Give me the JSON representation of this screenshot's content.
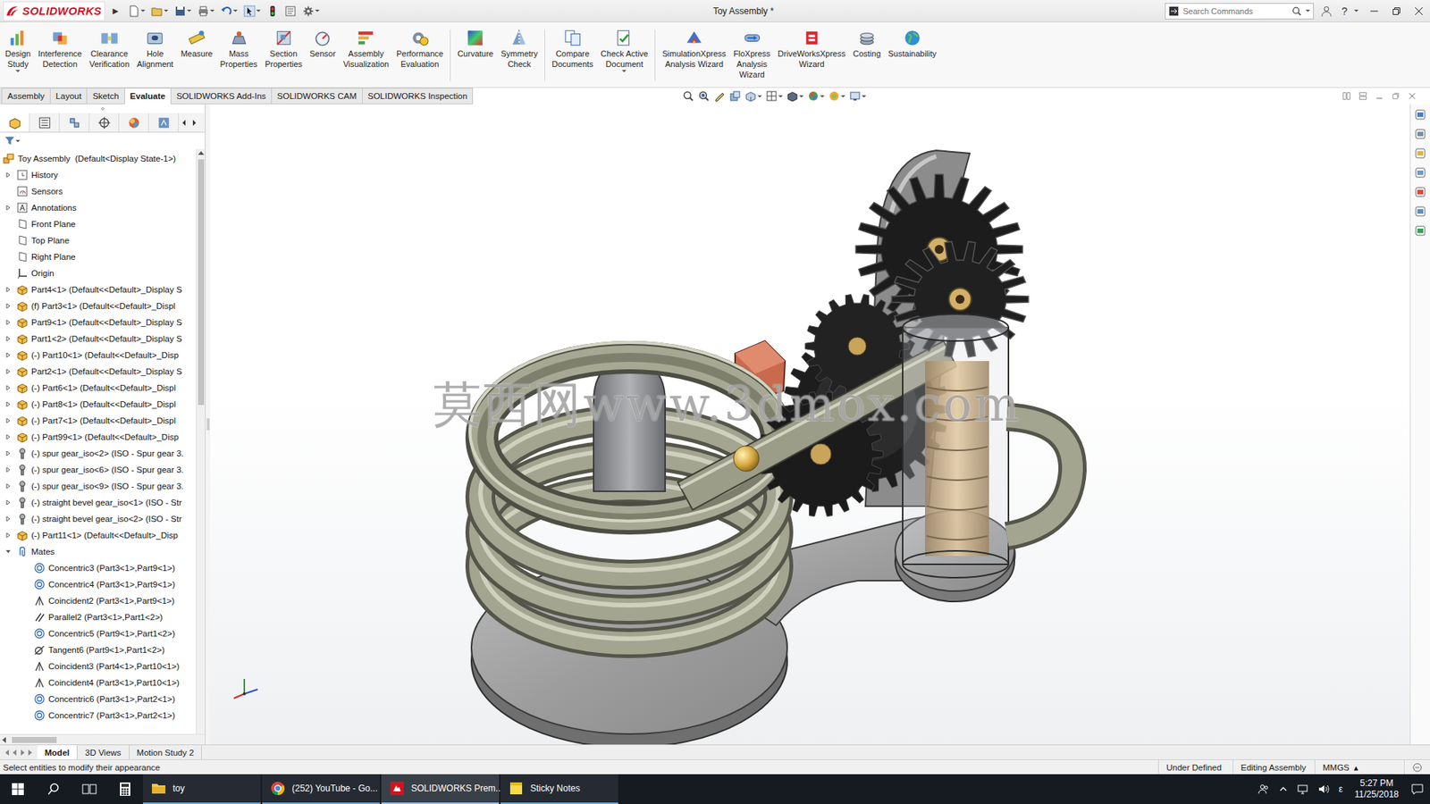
{
  "window": {
    "app_name": "SOLIDWORKS",
    "menu_arrow": "▶",
    "title": "Toy Assembly *",
    "search_placeholder": "Search Commands",
    "help": "?"
  },
  "ribbon": [
    {
      "lines": [
        "Design",
        "Study"
      ],
      "dropdown": true
    },
    {
      "lines": [
        "Interference",
        "Detection"
      ],
      "dropdown": false
    },
    {
      "lines": [
        "Clearance",
        "Verification"
      ],
      "dropdown": false
    },
    {
      "lines": [
        "Hole",
        "Alignment"
      ],
      "dropdown": false
    },
    {
      "lines": [
        "Measure"
      ],
      "dropdown": false
    },
    {
      "lines": [
        "Mass",
        "Properties"
      ],
      "dropdown": false
    },
    {
      "lines": [
        "Section",
        "Properties"
      ],
      "dropdown": false
    },
    {
      "lines": [
        "Sensor"
      ],
      "dropdown": false
    },
    {
      "lines": [
        "Assembly",
        "Visualization"
      ],
      "dropdown": false
    },
    {
      "lines": [
        "Performance",
        "Evaluation"
      ],
      "dropdown": false
    },
    {
      "lines": [
        "Curvature"
      ],
      "dropdown": false
    },
    {
      "lines": [
        "Symmetry",
        "Check"
      ],
      "dropdown": false
    },
    {
      "lines": [
        "Compare",
        "Documents"
      ],
      "dropdown": false
    },
    {
      "lines": [
        "Check Active",
        "Document"
      ],
      "dropdown": true
    },
    {
      "lines": [
        "SimulationXpress",
        "Analysis Wizard"
      ],
      "dropdown": false
    },
    {
      "lines": [
        "FloXpress",
        "Analysis",
        "Wizard"
      ],
      "dropdown": false
    },
    {
      "lines": [
        "DriveWorksXpress",
        "Wizard"
      ],
      "dropdown": false
    },
    {
      "lines": [
        "Costing"
      ],
      "dropdown": false
    },
    {
      "lines": [
        "Sustainability"
      ],
      "dropdown": false
    }
  ],
  "tabs": [
    {
      "label": "Assembly",
      "selected": false
    },
    {
      "label": "Layout",
      "selected": false
    },
    {
      "label": "Sketch",
      "selected": false
    },
    {
      "label": "Evaluate",
      "selected": true
    },
    {
      "label": "SOLIDWORKS Add-Ins",
      "selected": false
    },
    {
      "label": "SOLIDWORKS CAM",
      "selected": false
    },
    {
      "label": "SOLIDWORKS Inspection",
      "selected": false
    }
  ],
  "tree": [
    {
      "label": "Toy Assembly  (Default<Display State-1>)",
      "kind": "assembly",
      "expandable": false,
      "expanded": false,
      "indent": 0
    },
    {
      "label": "History",
      "kind": "history",
      "expandable": true,
      "expanded": false,
      "indent": 0
    },
    {
      "label": "Sensors",
      "kind": "sensor",
      "expandable": false,
      "expanded": false,
      "indent": 0
    },
    {
      "label": "Annotations",
      "kind": "annotation",
      "expandable": true,
      "expanded": false,
      "indent": 0
    },
    {
      "label": "Front Plane",
      "kind": "plane",
      "expandable": false,
      "expanded": false,
      "indent": 0
    },
    {
      "label": "Top Plane",
      "kind": "plane",
      "expandable": false,
      "expanded": false,
      "indent": 0
    },
    {
      "label": "Right Plane",
      "kind": "plane",
      "expandable": false,
      "expanded": false,
      "indent": 0
    },
    {
      "label": "Origin",
      "kind": "origin",
      "expandable": false,
      "expanded": false,
      "indent": 0
    },
    {
      "label": "Part4<1> (Default<<Default>_Display S",
      "kind": "part",
      "expandable": true,
      "expanded": false,
      "indent": 0
    },
    {
      "label": "(f) Part3<1> (Default<<Default>_Displ",
      "kind": "part",
      "expandable": true,
      "expanded": false,
      "indent": 0
    },
    {
      "label": "Part9<1> (Default<<Default>_Display S",
      "kind": "part",
      "expandable": true,
      "expanded": false,
      "indent": 0
    },
    {
      "label": "Part1<2> (Default<<Default>_Display S",
      "kind": "part",
      "expandable": true,
      "expanded": false,
      "indent": 0
    },
    {
      "label": "(-) Part10<1> (Default<<Default>_Disp",
      "kind": "part",
      "expandable": true,
      "expanded": false,
      "indent": 0
    },
    {
      "label": "Part2<1> (Default<<Default>_Display S",
      "kind": "part",
      "expandable": true,
      "expanded": false,
      "indent": 0
    },
    {
      "label": "(-) Part6<1> (Default<<Default>_Displ",
      "kind": "part",
      "expandable": true,
      "expanded": false,
      "indent": 0
    },
    {
      "label": "(-) Part8<1> (Default<<Default>_Displ",
      "kind": "part",
      "expandable": true,
      "expanded": false,
      "indent": 0
    },
    {
      "label": "(-) Part7<1> (Default<<Default>_Displ",
      "kind": "part",
      "expandable": true,
      "expanded": false,
      "indent": 0
    },
    {
      "label": "(-) Part99<1> (Default<<Default>_Disp",
      "kind": "part",
      "expandable": true,
      "expanded": false,
      "indent": 0
    },
    {
      "label": "(-) spur gear_iso<2> (ISO - Spur gear 3.",
      "kind": "toolbox",
      "expandable": true,
      "expanded": false,
      "indent": 0
    },
    {
      "label": "(-) spur gear_iso<6> (ISO - Spur gear 3.",
      "kind": "toolbox",
      "expandable": true,
      "expanded": false,
      "indent": 0
    },
    {
      "label": "(-) spur gear_iso<9> (ISO - Spur gear 3.",
      "kind": "toolbox",
      "expandable": true,
      "expanded": false,
      "indent": 0
    },
    {
      "label": "(-) straight bevel gear_iso<1> (ISO - Str",
      "kind": "toolbox",
      "expandable": true,
      "expanded": false,
      "indent": 0
    },
    {
      "label": "(-) straight bevel gear_iso<2> (ISO - Str",
      "kind": "toolbox",
      "expandable": true,
      "expanded": false,
      "indent": 0
    },
    {
      "label": "(-) Part11<1> (Default<<Default>_Disp",
      "kind": "part",
      "expandable": true,
      "expanded": false,
      "indent": 0
    },
    {
      "label": "Mates",
      "kind": "mates",
      "expandable": true,
      "expanded": true,
      "indent": 0
    },
    {
      "label": "Concentric3 (Part3<1>,Part9<1>)",
      "kind": "concentric",
      "expandable": false,
      "expanded": false,
      "indent": 1
    },
    {
      "label": "Concentric4 (Part3<1>,Part9<1>)",
      "kind": "concentric",
      "expandable": false,
      "expanded": false,
      "indent": 1
    },
    {
      "label": "Coincident2 (Part3<1>,Part9<1>)",
      "kind": "coincident",
      "expandable": false,
      "expanded": false,
      "indent": 1
    },
    {
      "label": "Parallel2 (Part3<1>,Part1<2>)",
      "kind": "parallel",
      "expandable": false,
      "expanded": false,
      "indent": 1
    },
    {
      "label": "Concentric5 (Part9<1>,Part1<2>)",
      "kind": "concentric",
      "expandable": false,
      "expanded": false,
      "indent": 1
    },
    {
      "label": "Tangent6 (Part9<1>,Part1<2>)",
      "kind": "tangent",
      "expandable": false,
      "expanded": false,
      "indent": 1
    },
    {
      "label": "Coincident3 (Part4<1>,Part10<1>)",
      "kind": "coincident",
      "expandable": false,
      "expanded": false,
      "indent": 1
    },
    {
      "label": "Coincident4 (Part3<1>,Part10<1>)",
      "kind": "coincident",
      "expandable": false,
      "expanded": false,
      "indent": 1
    },
    {
      "label": "Concentric6 (Part3<1>,Part2<1>)",
      "kind": "concentric",
      "expandable": false,
      "expanded": false,
      "indent": 1
    },
    {
      "label": "Concentric7 (Part3<1>,Part2<1>)",
      "kind": "concentric",
      "expandable": false,
      "expanded": false,
      "indent": 1
    }
  ],
  "watermark": "莫西网www.3dmox.com",
  "bottom_tabs": [
    {
      "label": "Model",
      "selected": true
    },
    {
      "label": "3D Views",
      "selected": false
    },
    {
      "label": "Motion Study 2",
      "selected": false
    }
  ],
  "status_bar": {
    "message": "Select entities to modify their appearance",
    "state": "Under Defined",
    "mode": "Editing Assembly",
    "units": "MMGS",
    "units_caret": "▴"
  },
  "taskbar": {
    "apps": [
      {
        "label": "toy",
        "kind": "folder",
        "selected": false
      },
      {
        "label": "(252) YouTube - Go...",
        "kind": "chrome",
        "selected": false
      },
      {
        "label": "SOLIDWORKS Prem...",
        "kind": "solidworks",
        "selected": true
      },
      {
        "label": "Sticky Notes",
        "kind": "sticky",
        "selected": false
      }
    ],
    "input_indicator": "ε",
    "time": "5:27 PM",
    "date": "11/25/2018"
  }
}
